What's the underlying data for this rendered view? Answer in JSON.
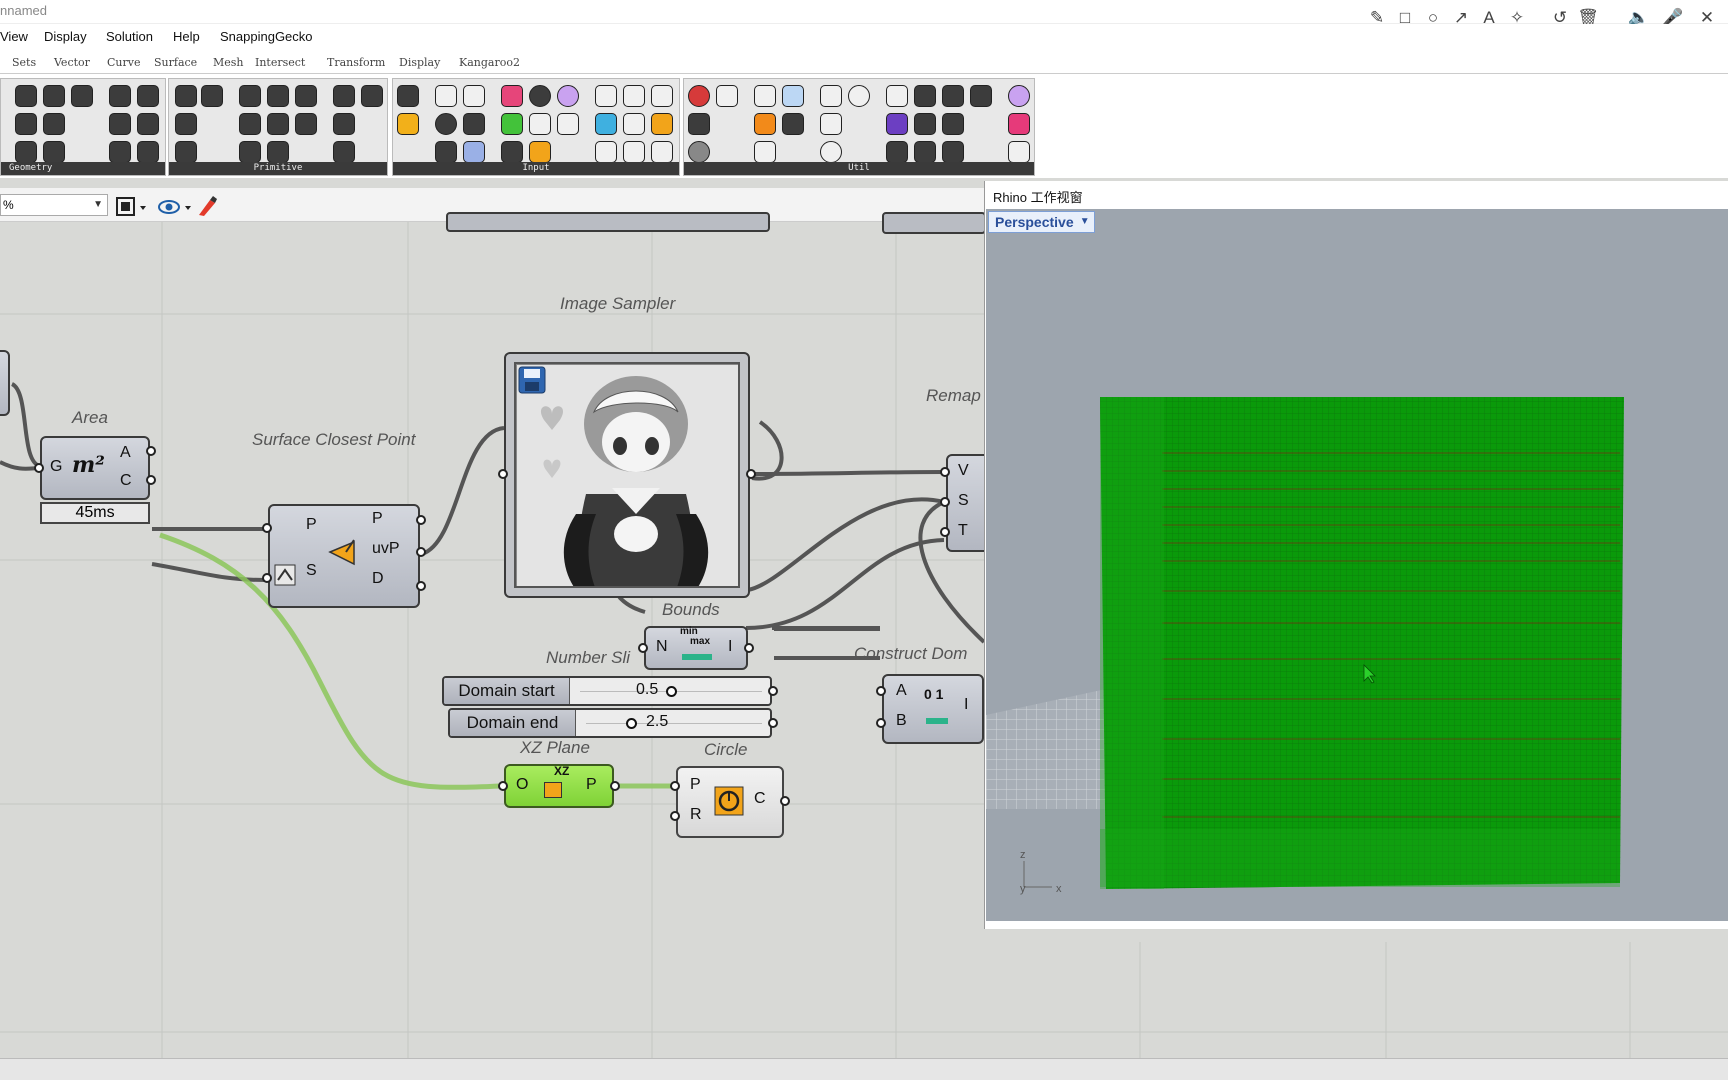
{
  "window": {
    "title": "nnamed",
    "controls": [
      "✎",
      "□",
      "○",
      "↗",
      "A",
      "✧",
      "↺",
      "🗑",
      "🔈",
      "🎤",
      "✕"
    ]
  },
  "menu": [
    "View",
    "Display",
    "Solution",
    "Help",
    "SnappingGecko"
  ],
  "tabs": [
    "Sets",
    "Vector",
    "Curve",
    "Surface",
    "Mesh",
    "Intersect",
    "Transform",
    "Display",
    "Kangaroo2"
  ],
  "ribbon": {
    "panels": [
      "Geometry",
      "Primitive",
      "Input",
      "Util"
    ]
  },
  "canvas_toolbar": {
    "zoom": "%"
  },
  "components": {
    "area": {
      "label": "Area",
      "in": "G",
      "out_a": "A",
      "out_c": "C",
      "icon": "m²",
      "timer": "45ms"
    },
    "surface_closest_point": {
      "label": "Surface Closest Point",
      "in_p": "P",
      "in_s": "S",
      "out_p": "P",
      "out_uvp": "uvP",
      "out_d": "D"
    },
    "image_sampler": {
      "label": "Image Sampler"
    },
    "remap": {
      "label": "Remap",
      "in_v": "V",
      "in_s": "S",
      "in_t": "T"
    },
    "bounds": {
      "label": "Bounds",
      "in": "N",
      "out": "I",
      "icon_top": "min",
      "icon_mid": "max"
    },
    "number_slider": {
      "label": "Number Sli"
    },
    "sliders": [
      {
        "name": "Domain start",
        "value": "0.5"
      },
      {
        "name": "Domain end",
        "value": "2.5"
      }
    ],
    "construct_domain": {
      "label": "Construct Dom",
      "in_a": "A",
      "in_b": "B",
      "out": "I",
      "icon": "0 1"
    },
    "xz_plane": {
      "label": "XZ Plane",
      "in": "O",
      "out": "P",
      "icon": "XZ"
    },
    "circle": {
      "label": "Circle",
      "in_p": "P",
      "in_r": "R",
      "out": "C"
    }
  },
  "rhino": {
    "title": "Rhino 工作视窗",
    "viewport": "Perspective",
    "axis_z": "z",
    "axis_y": "y",
    "axis_x": "x",
    "mesh_color": "#0a9a0a"
  }
}
